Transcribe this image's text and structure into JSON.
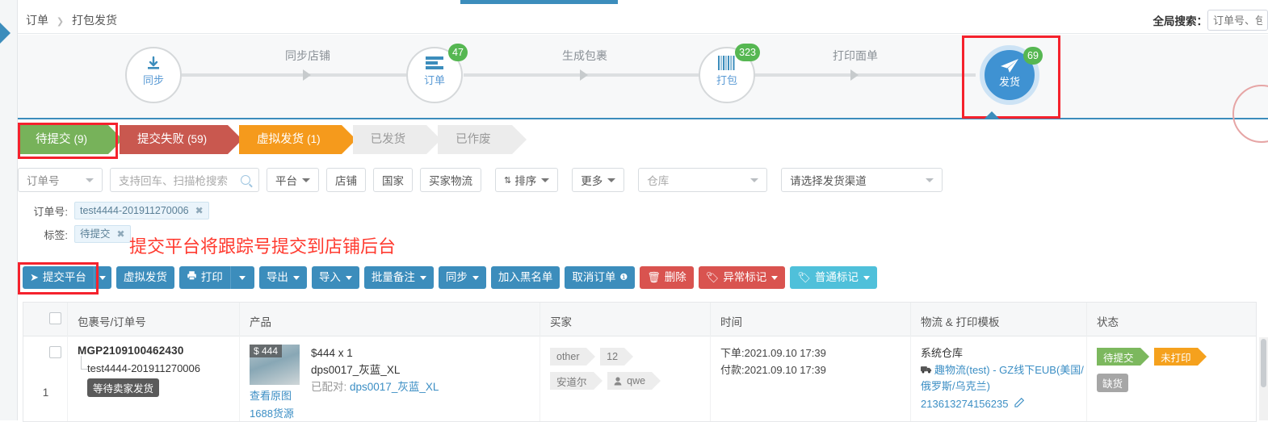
{
  "header": {
    "breadcrumb": [
      "订单",
      "打包发货"
    ],
    "global_search_label": "全局搜索：",
    "global_search_placeholder": "订单号、包"
  },
  "steps": {
    "items": [
      {
        "label": "同步",
        "icon": "download-icon",
        "badge": "",
        "active": false
      },
      {
        "label": "订单",
        "icon": "list-icon",
        "badge": "47",
        "active": false
      },
      {
        "label": "打包",
        "icon": "barcode-icon",
        "badge": "323",
        "active": false
      },
      {
        "label": "发货",
        "icon": "send-icon",
        "badge": "69",
        "active": true
      }
    ],
    "connectors": [
      "同步店铺",
      "生成包裹",
      "打印面单"
    ]
  },
  "tabs": [
    {
      "label": "待提交",
      "count": "(9)",
      "style": "green",
      "selected": true
    },
    {
      "label": "提交失败",
      "count": "(59)",
      "style": "red",
      "selected": false
    },
    {
      "label": "虚拟发货",
      "count": "(1)",
      "style": "orange",
      "selected": false
    },
    {
      "label": "已发货",
      "count": "",
      "style": "grey",
      "selected": false
    },
    {
      "label": "已作废",
      "count": "",
      "style": "grey",
      "selected": false
    }
  ],
  "filters": {
    "field_select": "订单号",
    "search_placeholder": "支持回车、扫描枪搜索",
    "platform": "平台",
    "shop": "店铺",
    "country": "国家",
    "buyer_logistics": "买家物流",
    "sort": "排序",
    "more": "更多",
    "warehouse_placeholder": "仓库",
    "channel_placeholder": "请选择发货渠道"
  },
  "chips": {
    "order_key": "订单号:",
    "order_value": "test4444-201911270006",
    "tag_key": "标签:",
    "tag_value": "待提交",
    "close": "✖"
  },
  "annotation": "提交平台将跟踪号提交到店铺后台",
  "toolbar": {
    "submit_platform": "提交平台",
    "virtual_ship": "虚拟发货",
    "print": "打印",
    "export": "导出",
    "import": "导入",
    "batch_note": "批量备注",
    "sync": "同步",
    "blacklist": "加入黑名单",
    "cancel_order": "取消订单",
    "delete": "删除",
    "abnormal_mark": "异常标记",
    "normal_mark": "普通标记",
    "icons": {
      "send": "➤",
      "printer": "🖶",
      "info": "❶",
      "trash": "🗑",
      "tag": "🏷"
    }
  },
  "table": {
    "headers": [
      "",
      "包裹号/订单号",
      "产品",
      "买家",
      "时间",
      "物流 & 打印模板",
      "状态"
    ],
    "rows": [
      {
        "index": "1",
        "package_no": "MGP2109100462430",
        "order_no": "test4444-201911270006",
        "order_tip": "等待卖家发货",
        "product": {
          "price_badge": "$ 444",
          "view_original": "查看原图",
          "source_1688": "1688货源",
          "line1": "$444 x 1",
          "line2": "dps0017_灰蓝_XL",
          "line3_label": "已配对: ",
          "line3_value": "dps0017_灰蓝_XL"
        },
        "buyer_tags": [
          "other",
          "12",
          "安道尔"
        ],
        "buyer_name": "qwe",
        "time_order_label": "下单:",
        "time_order_value": "2021.09.10 17:39",
        "time_pay_label": "付款:",
        "time_pay_value": "2021.09.10 17:39",
        "logistics": {
          "warehouse": "系统仓库",
          "channel": "趣物流(test) - GZ线下EUB(美国/俄罗斯/乌克兰)",
          "tracking_no": "213613274156235"
        },
        "status": [
          {
            "label": "待提交",
            "style": "green"
          },
          {
            "label": "未打印",
            "style": "orange"
          }
        ],
        "status_extra": "缺货"
      }
    ]
  },
  "colors": {
    "primary": "#3c8dbc",
    "green": "#77b25a",
    "red": "#c9584f",
    "orange": "#f59a1c",
    "highlight": "#f5222d"
  }
}
